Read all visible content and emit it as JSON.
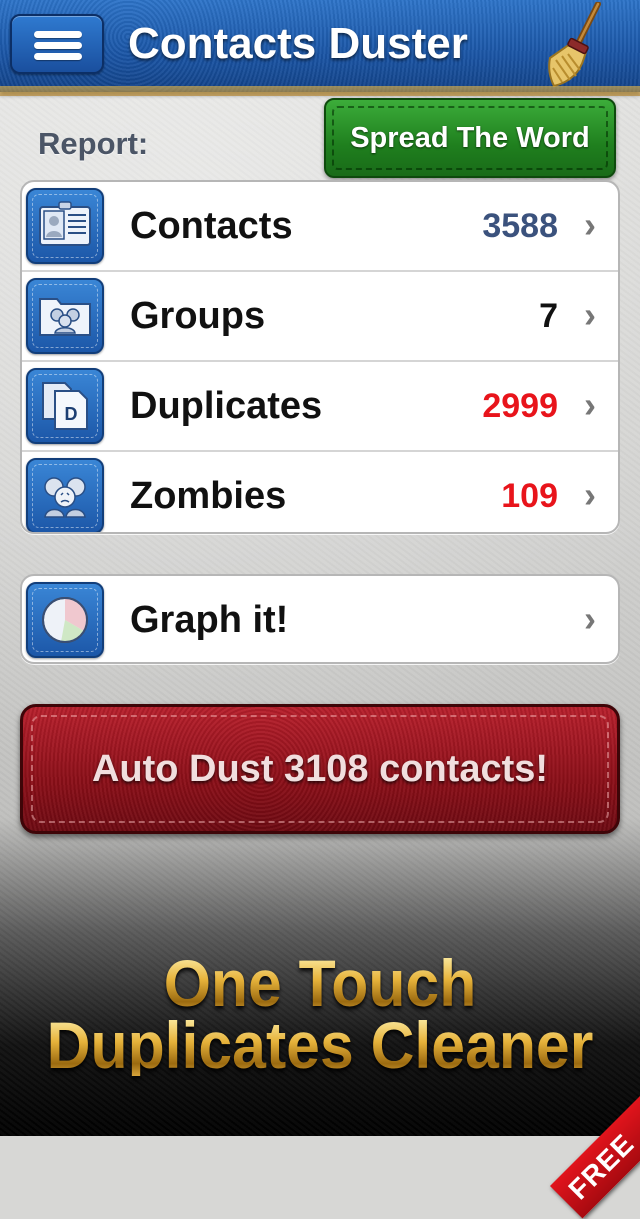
{
  "header": {
    "title": "Contacts Duster",
    "menu_icon": "hamburger-menu-icon",
    "logo_icon": "broom-icon",
    "brand_color": "#1a55a6"
  },
  "report": {
    "label": "Report:",
    "share_button_label": "Spread The Word"
  },
  "report_rows": [
    {
      "label": "Contacts",
      "count": "3588",
      "count_color": "#3b527d",
      "icon": "contact-card-icon"
    },
    {
      "label": "Groups",
      "count": "7",
      "count_color": "#111111",
      "icon": "group-folder-icon"
    },
    {
      "label": "Duplicates",
      "count": "2999",
      "count_color": "#e8141b",
      "icon": "duplicate-documents-icon"
    },
    {
      "label": "Zombies",
      "count": "109",
      "count_color": "#e8141b",
      "icon": "zombie-faces-icon"
    }
  ],
  "graph_row": {
    "label": "Graph it!",
    "icon": "pie-chart-icon"
  },
  "auto_dust": {
    "label": "Auto Dust 3108 contacts!"
  },
  "promo": {
    "line1": "One Touch",
    "line2": "Duplicates Cleaner",
    "ribbon": "FREE"
  },
  "chevron": "›"
}
